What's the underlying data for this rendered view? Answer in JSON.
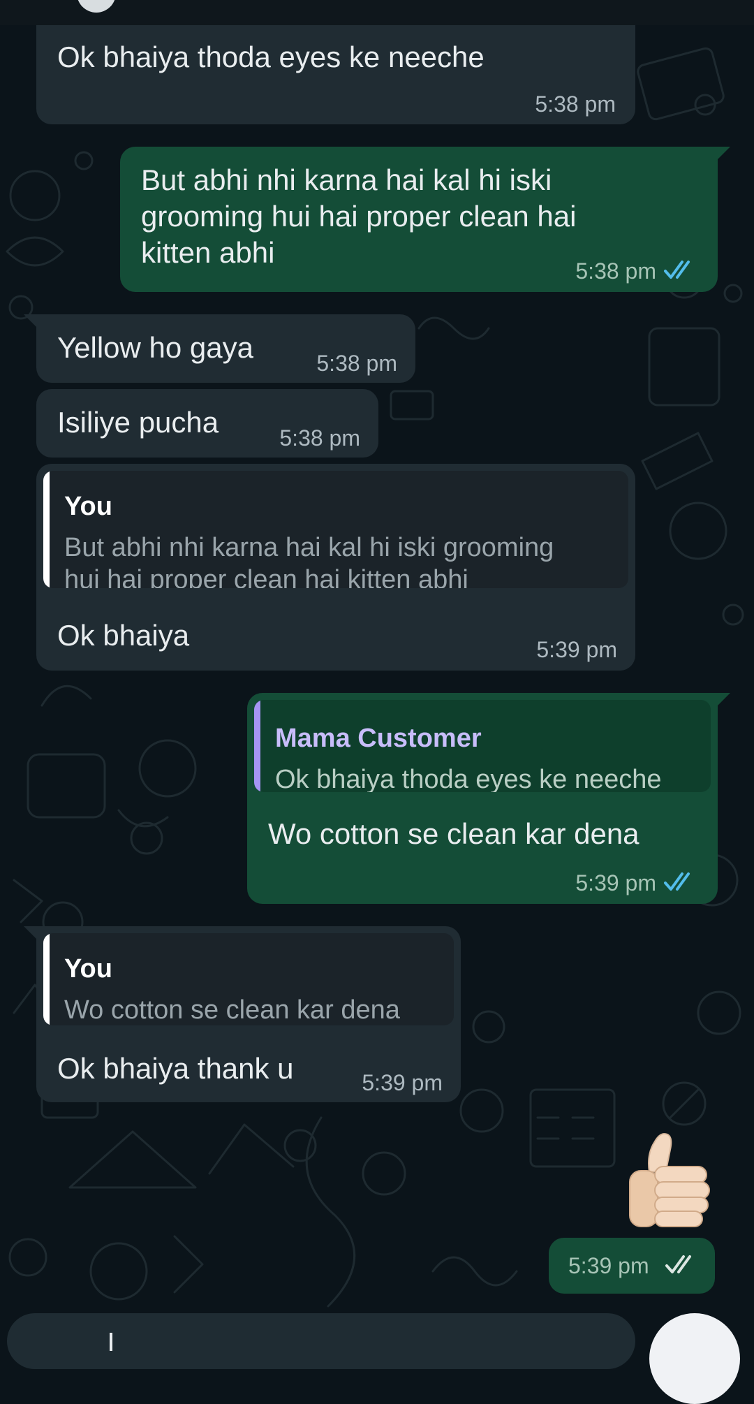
{
  "colors": {
    "background": "#0b141a",
    "incoming_bubble": "#202c33",
    "outgoing_bubble": "#144d37",
    "read_ticks": "#53bdeb",
    "quote_bar_self": "#ffffff",
    "quote_bar_contact": "#a695f4"
  },
  "messages": [
    {
      "text": "Ok bhaiya thoda eyes ke neeche",
      "time": "5:38 pm",
      "direction": "incoming"
    },
    {
      "lines": [
        "But abhi nhi karna hai kal hi iski",
        "grooming hui hai proper clean hai",
        "kitten abhi"
      ],
      "time": "5:38 pm",
      "direction": "outgoing",
      "status": "read"
    },
    {
      "text": "Yellow ho gaya",
      "time": "5:38 pm",
      "direction": "incoming"
    },
    {
      "text": "Isiliye pucha",
      "time": "5:38 pm",
      "direction": "incoming"
    },
    {
      "quote": {
        "author": "You",
        "lines": [
          "But abhi nhi karna hai kal hi iski grooming",
          "hui hai proper clean hai kitten abhi"
        ]
      },
      "text": "Ok bhaiya",
      "time": "5:39 pm",
      "direction": "incoming"
    },
    {
      "quote": {
        "author": "Mama Customer",
        "lines": [
          "Ok bhaiya thoda eyes ke neeche"
        ]
      },
      "text": "Wo cotton se clean kar dena",
      "time": "5:39 pm",
      "direction": "outgoing",
      "status": "read"
    },
    {
      "quote": {
        "author": "You",
        "lines": [
          "Wo cotton se clean kar dena"
        ]
      },
      "text": "Ok bhaiya thank u",
      "time": "5:39 pm",
      "direction": "incoming"
    },
    {
      "emoji": "thumbs-up",
      "time": "5:39 pm",
      "direction": "outgoing",
      "status": "read"
    }
  ],
  "icons": {
    "read_receipt": "double-check-icon",
    "send": "send-button",
    "thumbs_up": "thumbs-up-icon"
  }
}
